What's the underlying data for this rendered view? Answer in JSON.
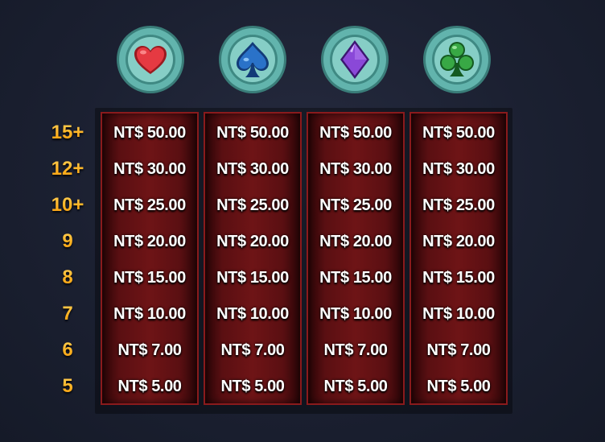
{
  "colors": {
    "coin_rim": "#5fb3ad",
    "coin_face": "#7cc8c0",
    "column_red": "#6e1416",
    "count_gold": "#ffb21f",
    "heart": "#d9242e",
    "spade": "#1f5fb0",
    "diamond": "#7a3cc8",
    "club": "#2a9a3a"
  },
  "suits": [
    {
      "icon": "heart-icon"
    },
    {
      "icon": "spade-icon"
    },
    {
      "icon": "diamond-icon"
    },
    {
      "icon": "club-icon"
    }
  ],
  "counts": [
    "15+",
    "12+",
    "10+",
    "9",
    "8",
    "7",
    "6",
    "5"
  ],
  "columns": [
    [
      "NT$ 50.00",
      "NT$ 30.00",
      "NT$ 25.00",
      "NT$ 20.00",
      "NT$ 15.00",
      "NT$ 10.00",
      "NT$ 7.00",
      "NT$ 5.00"
    ],
    [
      "NT$ 50.00",
      "NT$ 30.00",
      "NT$ 25.00",
      "NT$ 20.00",
      "NT$ 15.00",
      "NT$ 10.00",
      "NT$ 7.00",
      "NT$ 5.00"
    ],
    [
      "NT$ 50.00",
      "NT$ 30.00",
      "NT$ 25.00",
      "NT$ 20.00",
      "NT$ 15.00",
      "NT$ 10.00",
      "NT$ 7.00",
      "NT$ 5.00"
    ],
    [
      "NT$ 50.00",
      "NT$ 30.00",
      "NT$ 25.00",
      "NT$ 20.00",
      "NT$ 15.00",
      "NT$ 10.00",
      "NT$ 7.00",
      "NT$ 5.00"
    ]
  ]
}
